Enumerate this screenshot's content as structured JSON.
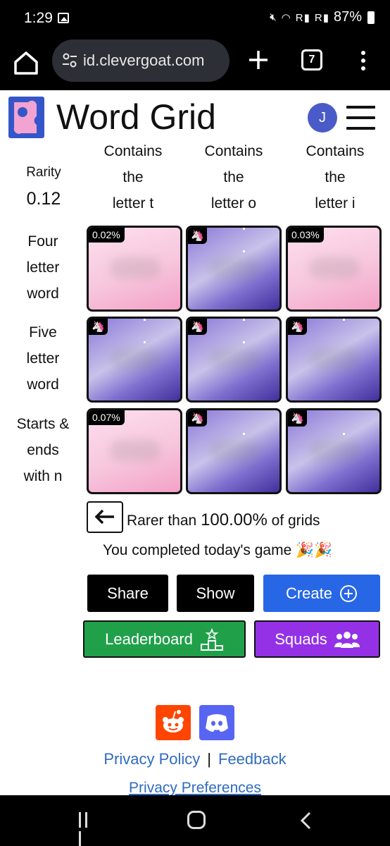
{
  "status": {
    "time": "1:29",
    "battery": "87%",
    "net": "R",
    "net2": "R"
  },
  "browser": {
    "url": "id.clevergoat.com",
    "tabs_count": "7"
  },
  "header": {
    "title": "Word Grid",
    "avatar_letter": "J"
  },
  "grid": {
    "rarity_label": "Rarity",
    "rarity_value": "0.12",
    "columns": [
      {
        "line1": "Contains",
        "line2": "the",
        "line3": "letter t"
      },
      {
        "line1": "Contains",
        "line2": "the",
        "line3": "letter o"
      },
      {
        "line1": "Contains",
        "line2": "the",
        "line3": "letter i"
      }
    ],
    "rows": [
      {
        "line1": "Four",
        "line2": "letter",
        "line3": "word"
      },
      {
        "line1": "Five",
        "line2": "letter",
        "line3": "word"
      },
      {
        "line1": "Starts &",
        "line2": "ends",
        "line3": "with n"
      }
    ],
    "cells": [
      {
        "badge": "0.02%",
        "style": "pink"
      },
      {
        "badge": "🦄",
        "style": "purple"
      },
      {
        "badge": "0.03%",
        "style": "pink"
      },
      {
        "badge": "🦄",
        "style": "purple"
      },
      {
        "badge": "🦄",
        "style": "purple"
      },
      {
        "badge": "🦄",
        "style": "purple"
      },
      {
        "badge": "0.07%",
        "style": "pink"
      },
      {
        "badge": "🦄",
        "style": "purple"
      },
      {
        "badge": "🦄",
        "style": "purple"
      }
    ]
  },
  "result": {
    "rarer_prefix": "Rarer than",
    "rarer_value": "100.00%",
    "rarer_suffix": "of grids",
    "completed": "You completed today's game 🎉🎉"
  },
  "buttons": {
    "share": "Share",
    "show": "Show",
    "create": "Create",
    "leaderboard": "Leaderboard",
    "squads": "Squads"
  },
  "footer": {
    "privacy_policy": "Privacy Policy",
    "separator": "|",
    "feedback": "Feedback",
    "privacy_preferences": "Privacy Preferences"
  },
  "colors": {
    "create": "#2767e6",
    "leaderboard": "#21a04a",
    "squads": "#9431e6",
    "reddit": "#ff4500",
    "discord": "#5865f2",
    "link": "#2f6cc1"
  }
}
